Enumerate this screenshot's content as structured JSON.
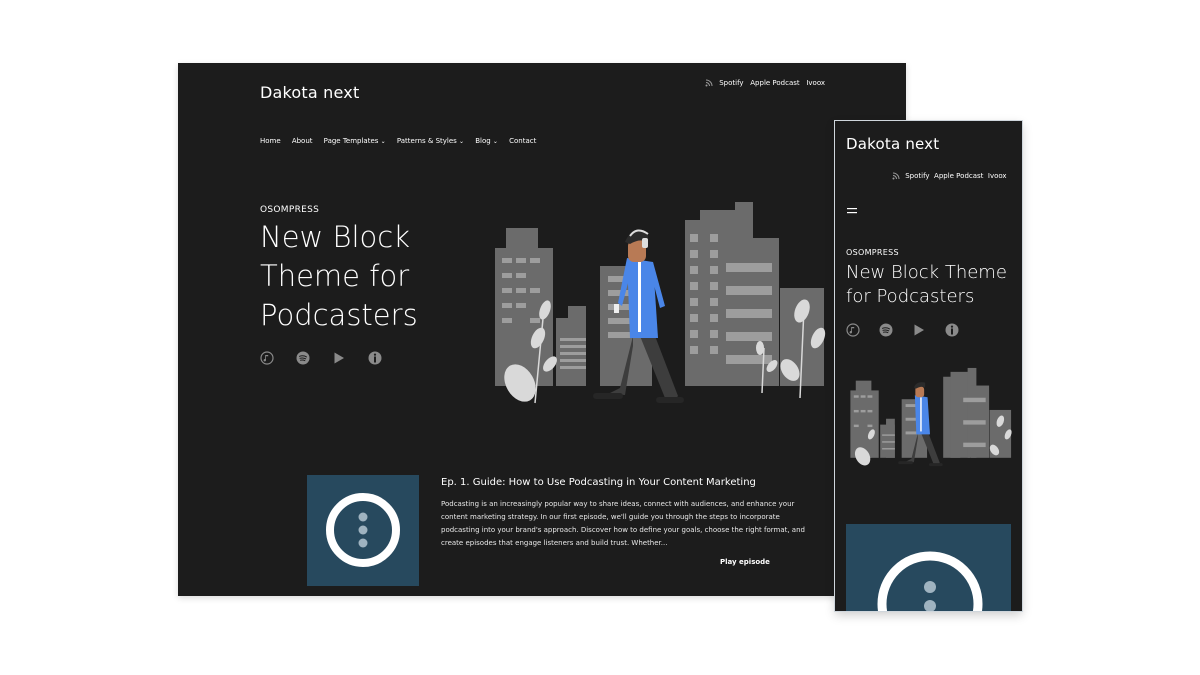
{
  "site": {
    "title": "Dakota next"
  },
  "top_links": [
    {
      "label": "Spotify",
      "icon": "rss-icon"
    },
    {
      "label": "Apple Podcast"
    },
    {
      "label": "Ivoox"
    }
  ],
  "nav": [
    {
      "label": "Home"
    },
    {
      "label": "About"
    },
    {
      "label": "Page Templates",
      "dropdown": true
    },
    {
      "label": "Patterns & Styles",
      "dropdown": true
    },
    {
      "label": "Blog",
      "dropdown": true
    },
    {
      "label": "Contact"
    }
  ],
  "hero": {
    "kicker": "OSOMPRESS",
    "title_lines": [
      "New Block",
      "Theme for",
      "Podcasters"
    ],
    "title_mobile_lines": [
      "New Block Theme",
      "for Podcasters"
    ],
    "platform_icons": [
      "apple-podcasts-icon",
      "spotify-icon",
      "google-play-icon",
      "ivoox-icon"
    ]
  },
  "episode": {
    "title": "Ep. 1. Guide: How to Use Podcasting in Your Content Marketing",
    "excerpt_lines": [
      "Podcasting is an increasingly popular way to share ideas, connect with audiences, and enhance your",
      "content marketing strategy. In our first episode, we'll guide you through the steps to incorporate",
      "podcasting into your brand's approach. Discover how to define your goals, choose the right format, and",
      "create episodes that engage listeners and build trust. Whether..."
    ],
    "play_label": "Play episode",
    "thumb_color": "#27495e"
  },
  "mobile": {
    "menu_icon": "hamburger-menu-icon"
  },
  "colors": {
    "background": "#1c1c1c",
    "accent_blue": "#4a86e8",
    "buildings": "#6b6b6b",
    "thumb": "#27495e"
  }
}
